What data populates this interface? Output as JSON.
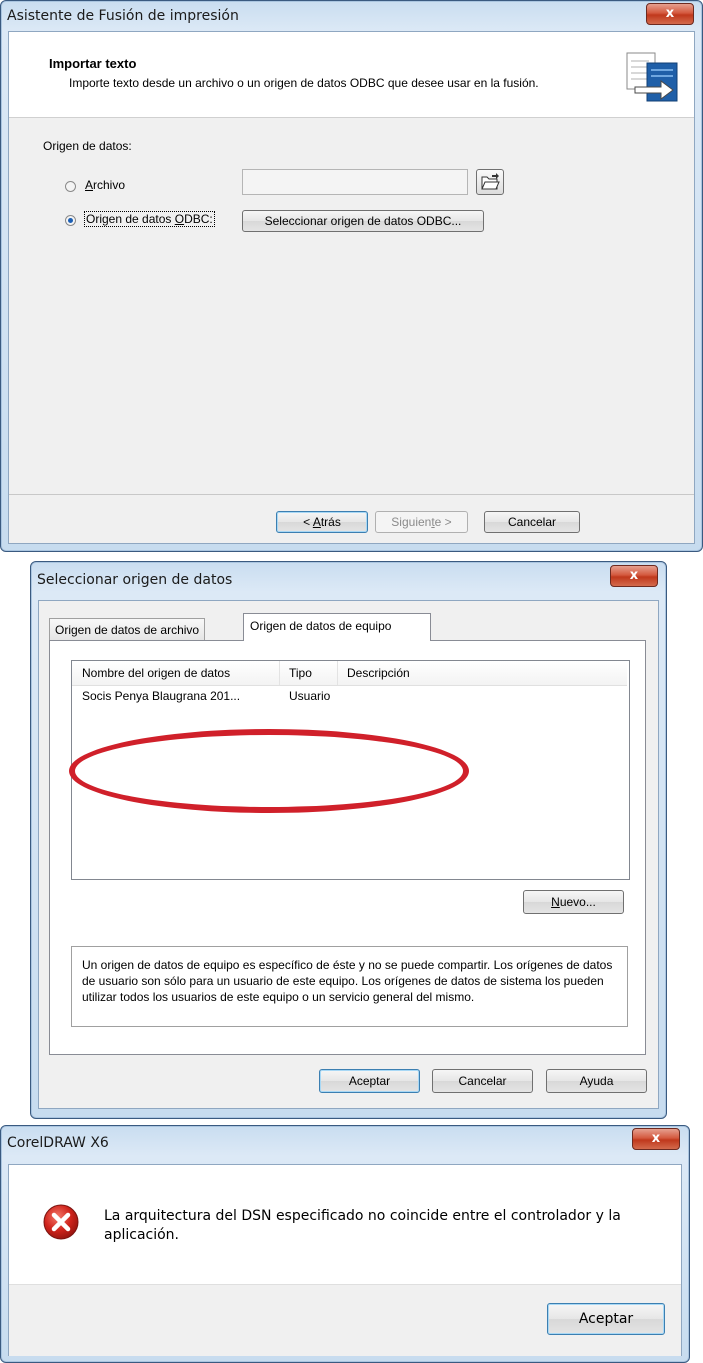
{
  "wizard": {
    "title": "Asistente de Fusión de impresión",
    "close": "x",
    "header_title": "Importar texto",
    "header_desc": "Importe texto desde un archivo o un origen de datos ODBC que desee usar en la fusión.",
    "group_label": "Origen de datos:",
    "radio_file": {
      "pre": "",
      "key": "A",
      "post": "rchivo",
      "selected": false
    },
    "radio_odbc": {
      "pre": "Origen de datos ",
      "key": "O",
      "post": "DBC:",
      "selected": true
    },
    "file_value": "",
    "odbc_button": "Seleccionar origen de datos ODBC...",
    "back": {
      "pre": "< ",
      "key": "A",
      "post": "trás"
    },
    "next": {
      "pre": "Siguien",
      "key": "t",
      "post": "e >"
    },
    "cancel": "Cancelar"
  },
  "dsn": {
    "title": "Seleccionar origen de datos",
    "close": "x",
    "tabs": [
      "Origen de datos de archivo",
      "Origen de datos de equipo"
    ],
    "active_tab": 1,
    "columns": [
      "Nombre del origen de datos",
      "Tipo",
      "Descripción"
    ],
    "rows": [
      [
        "Socis Penya Blaugrana 201...",
        "Usuario",
        ""
      ]
    ],
    "new_button": {
      "key": "N",
      "post": "uevo..."
    },
    "info": "Un origen de datos de equipo es específico de éste y no se puede compartir. Los orígenes de datos de usuario son sólo para un usuario de este equipo. Los orígenes de datos de sistema los pueden utilizar todos los usuarios de este equipo o un servicio general del mismo.",
    "ok": "Aceptar",
    "cancel": "Cancelar",
    "help": "Ayuda",
    "highlight_color": "#d0202a"
  },
  "error": {
    "title": "CorelDRAW X6",
    "close": "x",
    "message": "La arquitectura del DSN especificado no coincide entre el controlador y la aplicación.",
    "ok": "Aceptar",
    "icon": "error-icon"
  }
}
